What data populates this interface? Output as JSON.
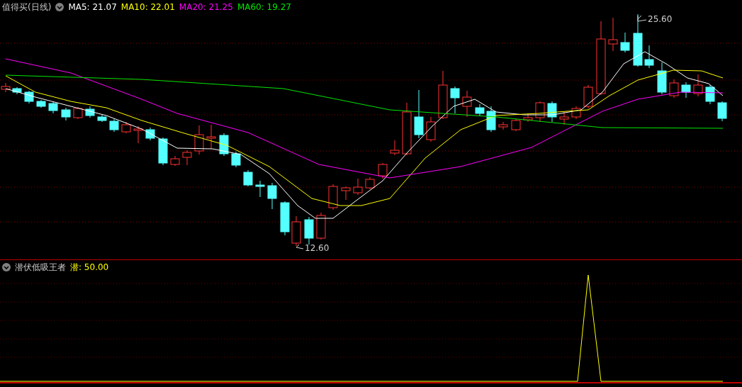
{
  "main_panel": {
    "title": "值得买(日线)",
    "indicators": [
      {
        "label": "MA5: 21.07",
        "color": "#ffffff"
      },
      {
        "label": "MA10: 22.01",
        "color": "#ffff00"
      },
      {
        "label": "MA20: 21.25",
        "color": "#ff00ff"
      },
      {
        "label": "MA60: 19.27",
        "color": "#00e600"
      }
    ],
    "high_label": "25.60",
    "low_label": "12.60"
  },
  "indicator_panel": {
    "title": "潜伏低吸王者",
    "indicators": [
      {
        "label": "潜: 50.00",
        "color": "#ffff00"
      }
    ]
  }
}
